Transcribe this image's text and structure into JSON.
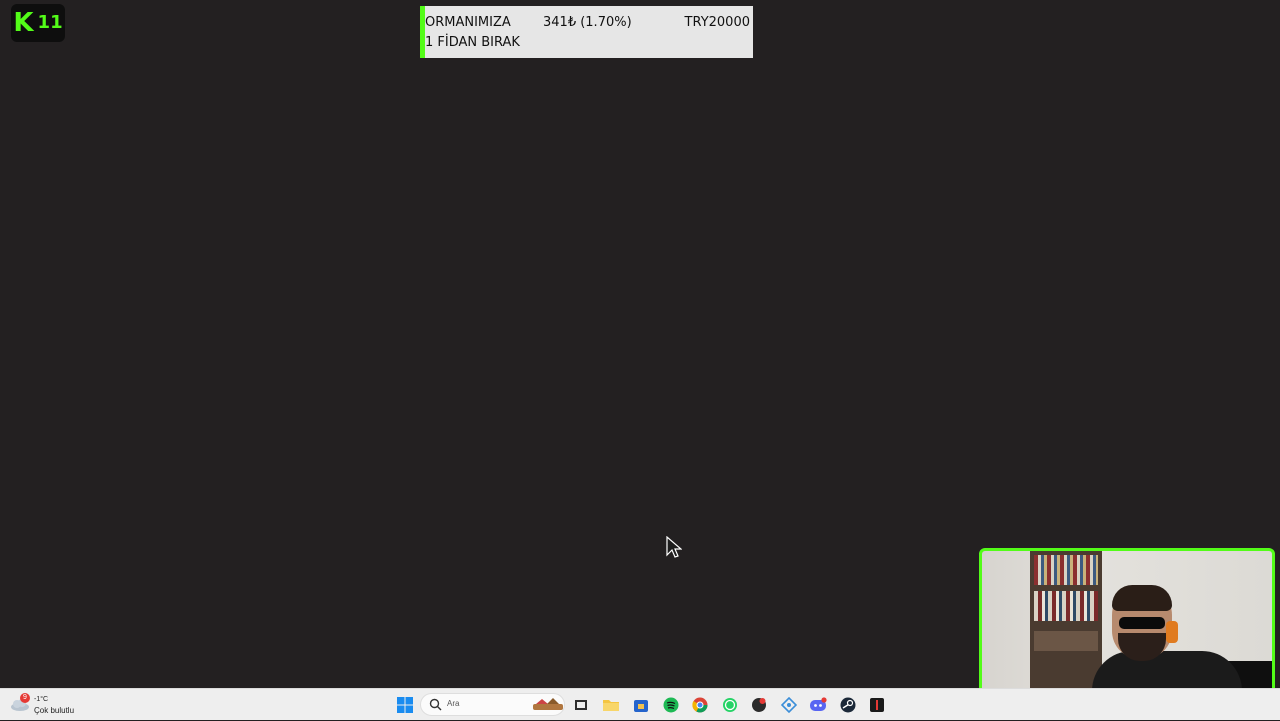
{
  "overlay_logo": {
    "letter": "K",
    "number": "11"
  },
  "donation": {
    "line1": "ORMANIMIZA",
    "amount": "341₺ (1.70%)",
    "goal": "TRY20000",
    "line2": "1 FİDAN BIRAK"
  },
  "taskbar": {
    "weather": {
      "temperature": "-1°C",
      "description": "Çok bulutlu",
      "badge": "9"
    },
    "search": {
      "placeholder": "Ara"
    },
    "icons": [
      "windows-start-icon",
      "search-icon",
      "task-view-icon",
      "file-explorer-icon",
      "store-icon",
      "spotify-icon",
      "chrome-icon",
      "whatsapp-icon",
      "app-icon",
      "network-icon",
      "discord-icon",
      "steam-icon",
      "red-app-icon"
    ]
  },
  "colors": {
    "accent": "#53fc18",
    "background": "#232021",
    "taskbar": "#eeeeee"
  }
}
